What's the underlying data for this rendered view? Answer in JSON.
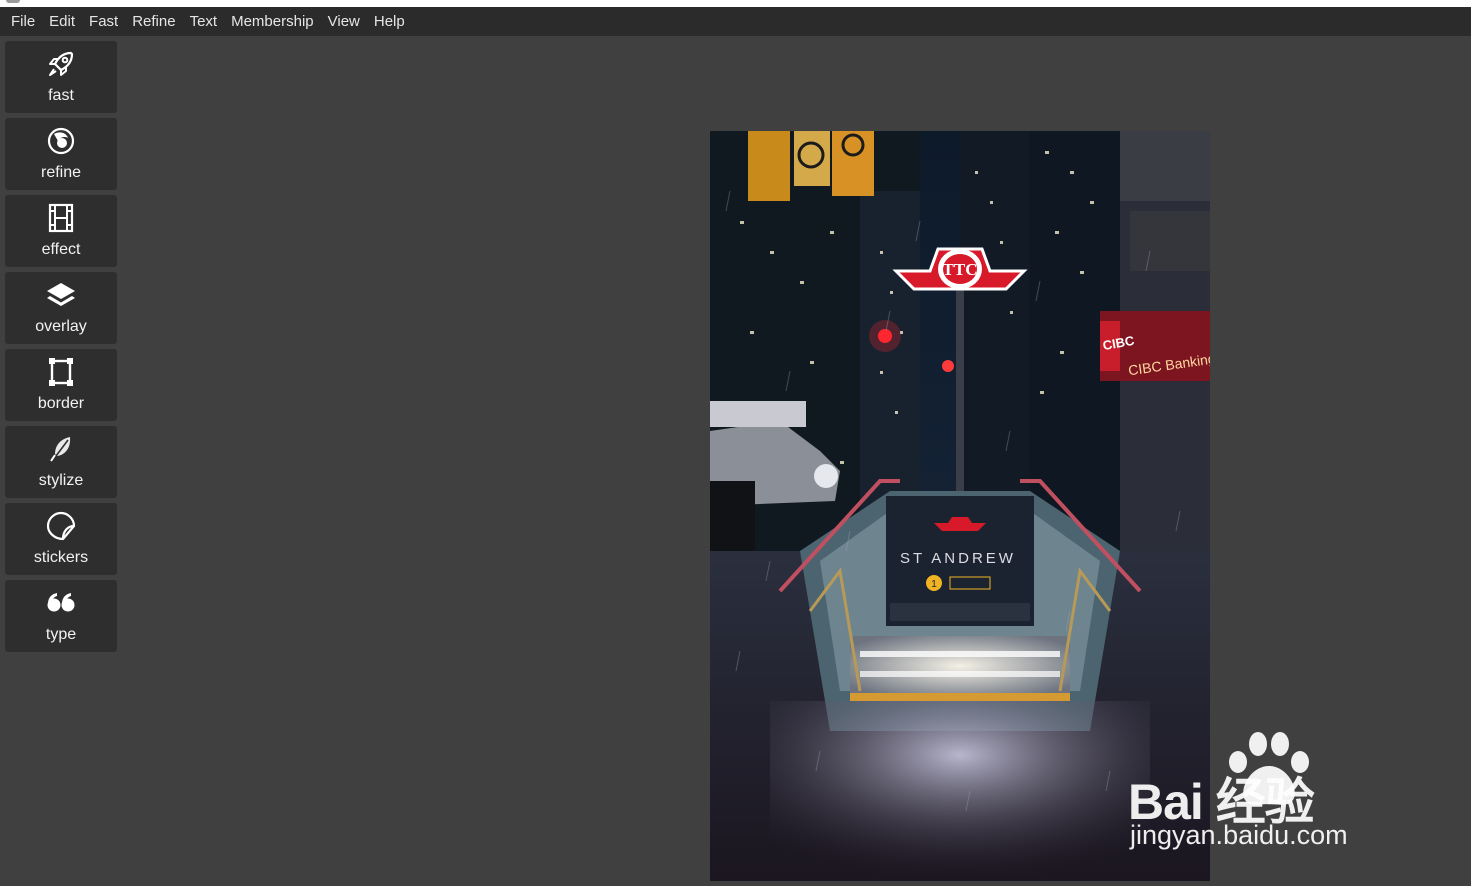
{
  "menubar": {
    "items": [
      "File",
      "Edit",
      "Fast",
      "Refine",
      "Text",
      "Membership",
      "View",
      "Help"
    ]
  },
  "toolbar": {
    "tools": [
      {
        "label": "fast",
        "icon": "rocket-icon"
      },
      {
        "label": "refine",
        "icon": "aperture-icon"
      },
      {
        "label": "effect",
        "icon": "film-icon"
      },
      {
        "label": "overlay",
        "icon": "layers-icon"
      },
      {
        "label": "border",
        "icon": "frame-icon"
      },
      {
        "label": "stylize",
        "icon": "feather-icon"
      },
      {
        "label": "stickers",
        "icon": "sticker-icon"
      },
      {
        "label": "type",
        "icon": "quote-icon"
      }
    ]
  },
  "photo": {
    "sign_station": "ST ANDREW",
    "sign_badge_number": "1",
    "sign_line": "LINE 1",
    "bank_logo": "CIBC",
    "bank_sign": "CIBC Banking Centre",
    "ttc_logo": "TTC"
  },
  "watermark": {
    "brand": "Bai  经验",
    "url": "jingyan.baidu.com"
  },
  "colors": {
    "background": "#404040",
    "menubar": "#2b2b2b",
    "tool_button": "#2e2e2e",
    "ttc_red": "#d7192a"
  }
}
